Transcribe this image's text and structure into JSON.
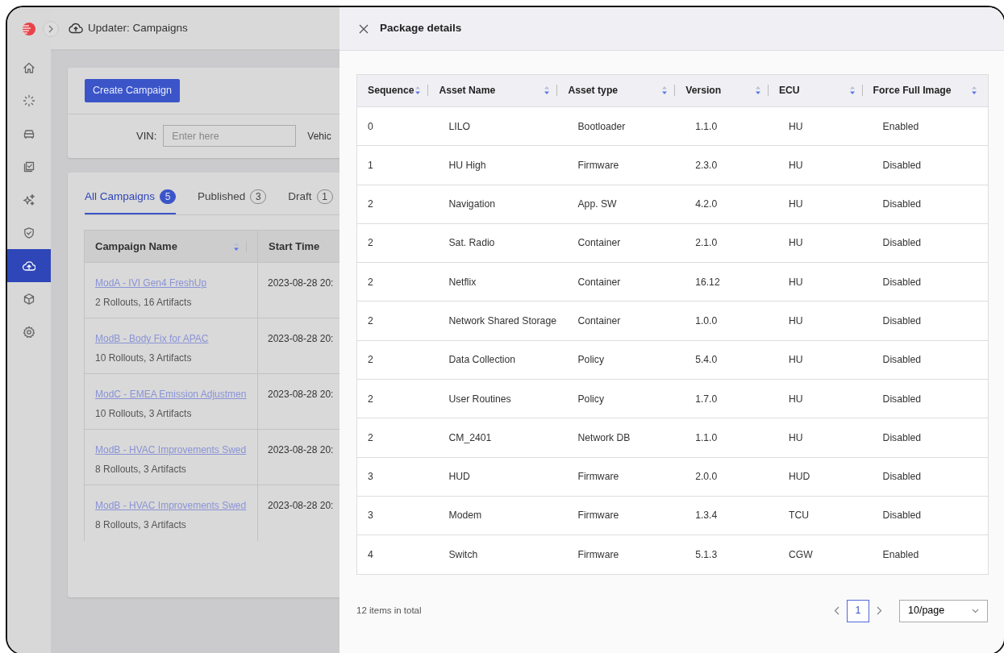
{
  "sidebar": {
    "items": [
      {
        "selected": false
      },
      {
        "selected": false
      },
      {
        "selected": false
      },
      {
        "selected": false
      },
      {
        "selected": false
      },
      {
        "selected": false
      },
      {
        "selected": true
      },
      {
        "selected": false
      },
      {
        "selected": false
      }
    ]
  },
  "header": {
    "title": "Updater: Campaigns"
  },
  "toolbar": {
    "create_button": "Create Campaign",
    "vin_label": "VIN:",
    "vin_placeholder": "Enter here",
    "vehicle_label": "Vehic"
  },
  "tabs": [
    {
      "label": "All Campaigns",
      "count": "5",
      "selected": true
    },
    {
      "label": "Published",
      "count": "3",
      "selected": false
    },
    {
      "label": "Draft",
      "count": "1",
      "selected": false
    }
  ],
  "campaigns": {
    "columns": [
      "Campaign Name",
      "Start Time"
    ],
    "rows": [
      {
        "name": "ModA - IVI Gen4 FreshUp",
        "summary": "2 Rollouts, 16 Artifacts",
        "start_time": "2023-08-28 20:"
      },
      {
        "name": "ModB - Body Fix for APAC",
        "summary": "10 Rollouts, 3 Artifacts",
        "start_time": "2023-08-28 20:"
      },
      {
        "name": "ModC - EMEA Emission Adjustmen",
        "summary": "10 Rollouts, 3 Artifacts",
        "start_time": "2023-08-28 20:"
      },
      {
        "name": "ModB - HVAC Improvements Swed",
        "summary": "8 Rollouts, 3 Artifacts",
        "start_time": "2023-08-28 20:"
      },
      {
        "name": "ModB - HVAC Improvements Swed",
        "summary": "8 Rollouts, 3 Artifacts",
        "start_time": "2023-08-28 20:"
      }
    ]
  },
  "drawer": {
    "title": "Package details",
    "columns": [
      "Sequence",
      "Asset Name",
      "Asset type",
      "Version",
      "ECU",
      "Force Full Image"
    ],
    "rows": [
      [
        "0",
        "LILO",
        "Bootloader",
        "1.1.0",
        "HU",
        "Enabled"
      ],
      [
        "1",
        "HU High",
        "Firmware",
        "2.3.0",
        "HU",
        "Disabled"
      ],
      [
        "2",
        "Navigation",
        "App. SW",
        "4.2.0",
        "HU",
        "Disabled"
      ],
      [
        "2",
        "Sat. Radio",
        "Container",
        "2.1.0",
        "HU",
        "Disabled"
      ],
      [
        "2",
        "Netflix",
        "Container",
        "16.12",
        "HU",
        "Disabled"
      ],
      [
        "2",
        "Network Shared Storage",
        "Container",
        "1.0.0",
        "HU",
        "Disabled"
      ],
      [
        "2",
        "Data Collection",
        "Policy",
        "5.4.0",
        "HU",
        "Disabled"
      ],
      [
        "2",
        "User Routines",
        "Policy",
        "1.7.0",
        "HU",
        "Disabled"
      ],
      [
        "2",
        "CM_2401",
        "Network DB",
        "1.1.0",
        "HU",
        "Disabled"
      ],
      [
        "3",
        "HUD",
        "Firmware",
        "2.0.0",
        "HUD",
        "Disabled"
      ],
      [
        "3",
        "Modem",
        "Firmware",
        "1.3.4",
        "TCU",
        "Disabled"
      ],
      [
        "4",
        "Switch",
        "Firmware",
        "5.1.3",
        "CGW",
        "Enabled"
      ]
    ],
    "total": "12 items in total",
    "pages": [
      {
        "label": "1",
        "selected": true
      }
    ],
    "page_size": "10/page"
  }
}
